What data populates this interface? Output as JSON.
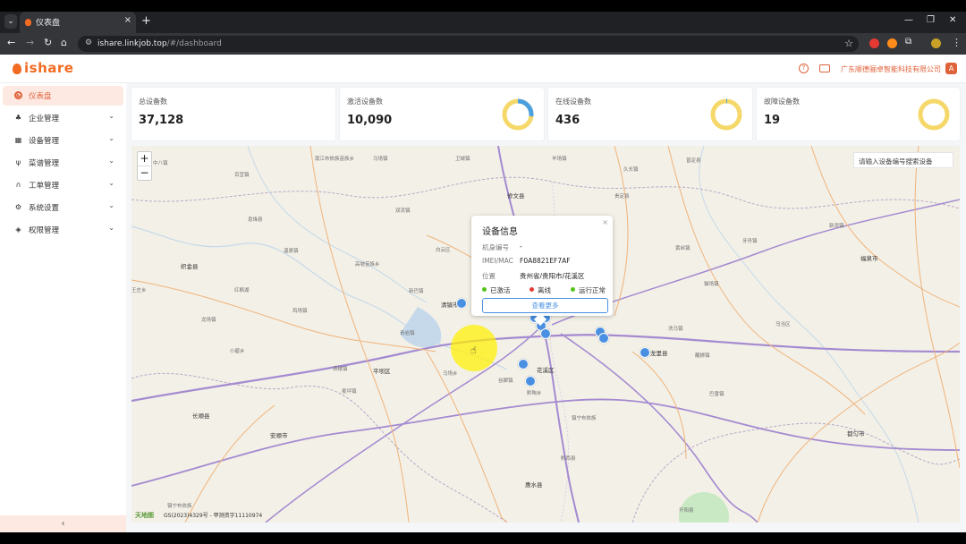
{
  "browser": {
    "tab_title": "仪表盘",
    "tab_close": "×",
    "new_tab": "+",
    "tab_switcher": "⌄",
    "url_host": "ishare.linkjob.top",
    "url_path": "/#/dashboard",
    "win_min": "—",
    "win_max": "❐",
    "win_close": "✕"
  },
  "app": {
    "logo": "ishare",
    "company": "广东顺德骊卓智能科技有限公司",
    "avatar": "A"
  },
  "sidebar": {
    "items": [
      {
        "label": "仪表盘",
        "icon": "dashboard-icon",
        "active": true
      },
      {
        "label": "企业管理",
        "icon": "org-icon"
      },
      {
        "label": "设备管理",
        "icon": "device-icon"
      },
      {
        "label": "菜谱管理",
        "icon": "fork-knife-icon"
      },
      {
        "label": "工单管理",
        "icon": "headset-icon"
      },
      {
        "label": "系统设置",
        "icon": "settings-icon"
      },
      {
        "label": "权限管理",
        "icon": "shield-icon"
      }
    ],
    "collapse": "‹"
  },
  "stats": [
    {
      "label": "总设备数",
      "value": "37,128"
    },
    {
      "label": "激活设备数",
      "value": "10,090",
      "ring_fraction": 0.27,
      "color": "#4a9fe0"
    },
    {
      "label": "在线设备数",
      "value": "436",
      "ring_fraction": 0.01,
      "color": "#4a9fe0"
    },
    {
      "label": "故障设备数",
      "value": "19",
      "ring_fraction": 0.0,
      "color": "#4a9fe0"
    }
  ],
  "ring_base_color": "#f5d869",
  "map": {
    "zoom_in": "+",
    "zoom_out": "−",
    "search_placeholder": "请输入设备编号搜索设备",
    "copyright": "GS(2023)4329号 - 甲测资字11110974",
    "provider": "天地图",
    "labels": [
      "贵阳市",
      "清镇市",
      "花溪区",
      "龙里县",
      "修文县",
      "安顺市",
      "织金县",
      "平坝区",
      "福泉市",
      "都匀市",
      "惠水县",
      "开阳县",
      "镇宁布依族",
      "黔西县",
      "乌当区",
      "白云区",
      "息烽县",
      "长顺县",
      "贵定县",
      "普定县",
      "双流镇",
      "百宜镇",
      "南江布依族苗族乡",
      "马场镇",
      "卫城镇",
      "羊场镇",
      "久长镇",
      "温泉镇",
      "高坡苗族乡",
      "新巴镇",
      "王庄乡",
      "红枫湖",
      "黔陶乡",
      "青岩镇",
      "马场乡",
      "燕楼镇",
      "小碧乡",
      "麦坪镇",
      "谷脚镇",
      "醒狮镇",
      "巴香镇",
      "洗马镇",
      "黄丝镇",
      "牙舟镇",
      "龙场镇",
      "新添镇",
      "猫场镇",
      "中八镇",
      "鸡场镇"
    ],
    "device_popup": {
      "title": "设备信息",
      "rows": [
        {
          "label": "机身编号",
          "value": "-"
        },
        {
          "label": "IMEI/MAC",
          "value": "F0A8821EF7AF"
        },
        {
          "label": "位置",
          "value": "贵州省/贵阳市/花溪区"
        }
      ],
      "legend": [
        {
          "label": "已激活",
          "color": "#52c41a"
        },
        {
          "label": "离线",
          "color": "#e53935"
        },
        {
          "label": "运行正常",
          "color": "#52c41a"
        }
      ],
      "button": "查看更多",
      "close": "×"
    },
    "device_markers": 12
  }
}
